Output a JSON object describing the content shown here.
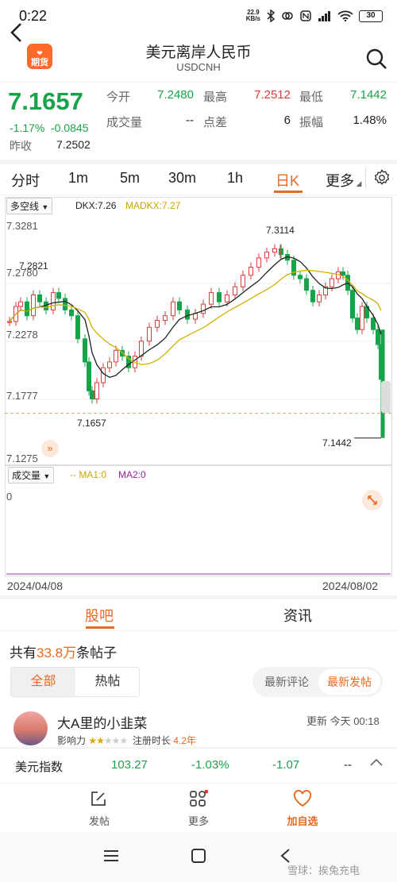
{
  "status": {
    "time": "0:22",
    "net_speed": "22.9",
    "net_unit": "KB/s",
    "battery": "30"
  },
  "header": {
    "title": "美元离岸人民币",
    "subtitle": "USDCNH",
    "app_badge": "期货"
  },
  "quote": {
    "price": "7.1657",
    "change_pct": "-1.17%",
    "change": "-0.0845",
    "prev_close_label": "昨收",
    "prev_close": "7.2502",
    "stats": [
      {
        "label": "今开",
        "value": "7.2480",
        "color": "green"
      },
      {
        "label": "最高",
        "value": "7.2512",
        "color": "red"
      },
      {
        "label": "最低",
        "value": "7.1442",
        "color": "green"
      },
      {
        "label": "成交量",
        "value": "--",
        "color": "plain"
      },
      {
        "label": "点差",
        "value": "6",
        "color": "plain"
      },
      {
        "label": "振幅",
        "value": "1.48%",
        "color": "plain"
      }
    ]
  },
  "tabs": [
    "分时",
    "1m",
    "5m",
    "30m",
    "1h",
    "日K",
    "更多"
  ],
  "active_tab": "日K",
  "chart": {
    "indicator_select": "多空线",
    "indicator_text1": "DKX:7.26",
    "indicator_text2": "MADKX:7.27",
    "y_ticks": [
      "7.3281",
      "7.2780",
      "7.2278",
      "7.1777",
      "7.1275"
    ],
    "annotations": {
      "high": "7.3114",
      "left_high": "7.2821",
      "low": "7.1657",
      "last_low": "7.1442"
    },
    "volume_select": "成交量",
    "volume_ma": "-- MA1:0",
    "volume_ma2": "MA2:0",
    "volume_zero": "0",
    "date_start": "2024/04/08",
    "date_end": "2024/08/02"
  },
  "chart_data": {
    "type": "candlestick",
    "ylim": [
      7.1275,
      7.3281
    ],
    "series_colors": {
      "up": "#e23a3a",
      "down": "#16a34a",
      "dkx": "#222222",
      "madkx": "#d4b000"
    },
    "high_marker": 7.3114,
    "low_marker": 7.1442
  },
  "section": {
    "tab1": "股吧",
    "tab2": "资讯",
    "posts_prefix": "共有",
    "posts_count": "33.8万",
    "posts_suffix": "条帖子"
  },
  "filters": {
    "all": "全部",
    "hot": "热帖",
    "sort1": "最新评论",
    "sort2": "最新发帖"
  },
  "post": {
    "user": "大A里的小韭菜",
    "influence_label": "影响力",
    "reg_label": "注册时长",
    "reg_value": "4.2年",
    "update": "更新 今天 00:18"
  },
  "ticker": {
    "name": "美元指数",
    "value": "103.27",
    "pct": "-1.03%",
    "change": "-1.07",
    "extra": "--"
  },
  "nav": {
    "post": "发帖",
    "more": "更多",
    "watch": "加自选"
  },
  "watermark": "雪球：挨兔充电"
}
